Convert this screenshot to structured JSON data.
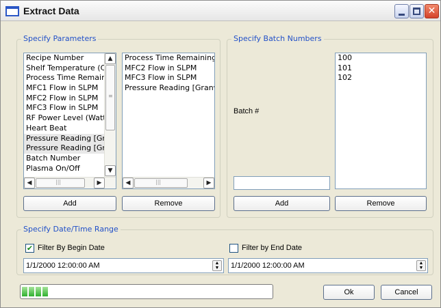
{
  "window": {
    "title": "Extract Data"
  },
  "parameters": {
    "label": "Specify Parameters",
    "available": [
      "Recipe Number",
      "Shelf Temperature (Ce",
      "Process Time Remainir",
      "MFC1 Flow in SLPM",
      "MFC2 Flow in SLPM",
      "MFC3 Flow in SLPM",
      "RF Power Level (Watt",
      "Heart Beat",
      "Pressure Reading [Gra",
      "Pressure Reading [Gra",
      "Batch Number",
      "Plasma On/Off"
    ],
    "selected": [
      "Process Time Remaining (",
      "MFC2 Flow in SLPM",
      "MFC3 Flow in SLPM",
      "Pressure Reading [Granvi"
    ],
    "add_label": "Add",
    "remove_label": "Remove"
  },
  "batch": {
    "label": "Specify Batch Numbers",
    "field_label": "Batch #",
    "numbers": [
      "100",
      "101",
      "102"
    ],
    "input_value": "",
    "add_label": "Add",
    "remove_label": "Remove"
  },
  "date_range": {
    "label": "Specify Date/Time Range",
    "begin": {
      "label": "Filter By Begin Date",
      "checked": true,
      "value": "1/1/2000 12:00:00 AM"
    },
    "end": {
      "label": "Filter by End Date",
      "checked": false,
      "value": "1/1/2000 12:00:00 AM"
    }
  },
  "progress": {
    "fraction": 0.11
  },
  "footer": {
    "ok_label": "Ok",
    "cancel_label": "Cancel"
  },
  "icons": {
    "window": "window-icon",
    "minimize": "minimize-icon",
    "maximize": "maximize-icon",
    "close": "close-icon",
    "scroll_up": "scroll-up-arrow-icon",
    "scroll_down": "scroll-down-arrow-icon",
    "scroll_left": "scroll-left-arrow-icon",
    "scroll_right": "scroll-right-arrow-icon",
    "spin": "spin-updown-icon",
    "check": "checkmark-icon"
  },
  "colors": {
    "group_label": "#2150c8",
    "progress": "#2fb12f",
    "close_button": "#d4422a"
  }
}
